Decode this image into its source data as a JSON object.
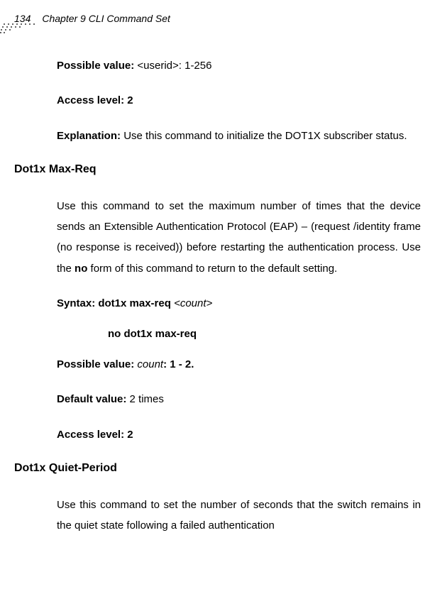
{
  "header": {
    "page_number": "134",
    "chapter": "Chapter 9 CLI Command Set"
  },
  "sections": {
    "possible_value_1": {
      "label": "Possible value: ",
      "rest": "<userid>: 1-256"
    },
    "access_level_1": {
      "label": "Access level: 2"
    },
    "explanation": {
      "label": "Explanation: ",
      "rest": "Use this command to initialize the DOT1X subscriber status."
    },
    "heading_maxreq": "Dot1x Max-Req",
    "maxreq_desc": {
      "text_a": "Use this command to set the maximum number of times that the device sends an Extensible Authentication Protocol (EAP) – (request /identity frame (no response is received)) before restarting the authentication process. Use the ",
      "bold_no": "no",
      "text_b": " form of this command to return to the default setting."
    },
    "syntax": {
      "label": "Syntax: dot1x max-req ",
      "arg": " <count>"
    },
    "no_line": "no dot1x max-req",
    "possible_value_2": {
      "label": "Possible value: ",
      "arg": "count",
      "rest": ": 1 - 2."
    },
    "default_value": {
      "label": "Default value: ",
      "rest": "2 times"
    },
    "access_level_2": {
      "label": "Access level: 2"
    },
    "heading_quiet": "Dot1x Quiet-Period",
    "quiet_desc": "Use this command to set the number of seconds that the switch remains in the quiet state following a failed authentication"
  }
}
